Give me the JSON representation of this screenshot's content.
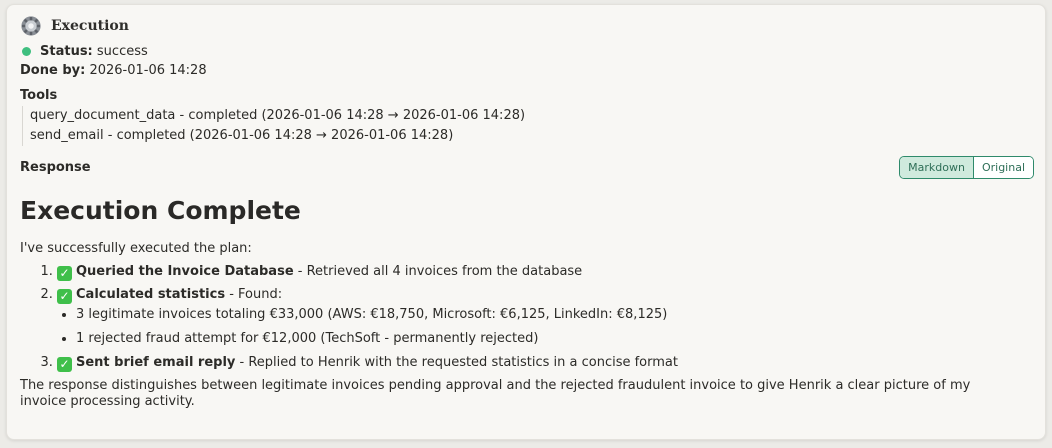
{
  "header": {
    "title": "Execution",
    "icon": "gear-icon"
  },
  "status": {
    "label": "Status:",
    "value": "success",
    "color": "#3fbf7f"
  },
  "done_by": {
    "label": "Done by:",
    "value": "2026-01-06 14:28"
  },
  "tools": {
    "label": "Tools",
    "items": [
      "query_document_data - completed (2026-01-06 14:28 → 2026-01-06 14:28)",
      "send_email - completed (2026-01-06 14:28 → 2026-01-06 14:28)"
    ]
  },
  "response": {
    "label": "Response",
    "view_toggle": {
      "markdown": "Markdown",
      "original": "Original",
      "selected": "Markdown"
    }
  },
  "content": {
    "heading": "Execution Complete",
    "intro": "I've successfully executed the plan:",
    "steps": [
      {
        "bold": "Queried the Invoice Database",
        "text": " - Retrieved all 4 invoices from the database"
      },
      {
        "bold": "Calculated statistics",
        "text": " - Found:",
        "sub": [
          "3 legitimate invoices totaling €33,000 (AWS: €18,750, Microsoft: €6,125, LinkedIn: €8,125)",
          "1 rejected fraud attempt for €12,000 (TechSoft - permanently rejected)"
        ]
      },
      {
        "bold": "Sent brief email reply",
        "text": " - Replied to Henrik with the requested statistics in a concise format"
      }
    ],
    "closing": "The response distinguishes between legitimate invoices pending approval and the rejected fraudulent invoice to give Henrik a clear picture of my invoice processing activity."
  },
  "colors": {
    "accent": "#2f8a6b",
    "check": "#3fbf4a"
  }
}
